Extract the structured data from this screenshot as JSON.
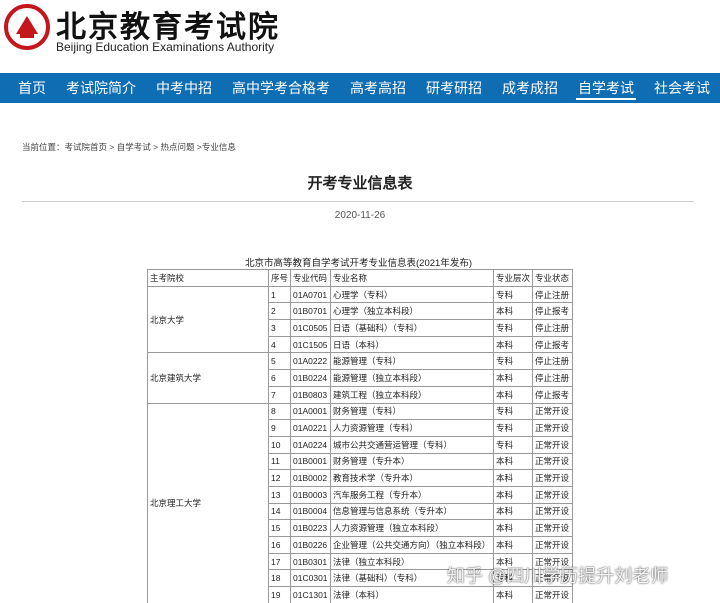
{
  "header": {
    "logo_cn": "北京教育考试院",
    "logo_en": "Beijing Education Examinations Authority",
    "brand_color": "#c4161c"
  },
  "nav": {
    "color": "#0e6db3",
    "items": [
      "首页",
      "考试院简介",
      "中考中招",
      "高中学考合格考",
      "高考高招",
      "研考研招",
      "成考成招",
      "自学考试",
      "社会考试"
    ],
    "active": "自学考试"
  },
  "breadcrumb": {
    "prefix": "当前位置：",
    "items": [
      "考试院首页",
      "自学考试",
      "热点问题",
      "专业信息"
    ],
    "separator": ">"
  },
  "article": {
    "title": "开考专业信息表",
    "date": "2020-11-26"
  },
  "table": {
    "caption": "北京市高等教育自学考试开考专业信息表(2021年发布)",
    "headers": [
      "主考院校",
      "序号",
      "专业代码",
      "专业名称",
      "专业层次",
      "专业状态"
    ],
    "groups": [
      {
        "school": "北京大学",
        "rows": [
          [
            "1",
            "01A0701",
            "心理学（专科）",
            "专科",
            "停止注册"
          ],
          [
            "2",
            "01B0701",
            "心理学（独立本科段）",
            "本科",
            "停止报考"
          ],
          [
            "3",
            "01C0505",
            "日语（基础科）（专科）",
            "专科",
            "停止注册"
          ],
          [
            "4",
            "01C1505",
            "日语（本科）",
            "本科",
            "停止报考"
          ]
        ]
      },
      {
        "school": "北京建筑大学",
        "rows": [
          [
            "5",
            "01A0222",
            "能源管理（专科）",
            "专科",
            "停止注册"
          ],
          [
            "6",
            "01B0224",
            "能源管理（独立本科段）",
            "本科",
            "停止注册"
          ],
          [
            "7",
            "01B0803",
            "建筑工程（独立本科段）",
            "本科",
            "停止报考"
          ]
        ]
      },
      {
        "school": "北京理工大学",
        "rows": [
          [
            "8",
            "01A0001",
            "财务管理（专科）",
            "专科",
            "正常开设"
          ],
          [
            "9",
            "01A0221",
            "人力资源管理（专科）",
            "专科",
            "正常开设"
          ],
          [
            "10",
            "01A0224",
            "城市公共交通营运管理（专科）",
            "专科",
            "正常开设"
          ],
          [
            "11",
            "01B0001",
            "财务管理（专升本）",
            "本科",
            "正常开设"
          ],
          [
            "12",
            "01B0002",
            "教育技术学（专升本）",
            "本科",
            "正常开设"
          ],
          [
            "13",
            "01B0003",
            "汽车服务工程（专升本）",
            "本科",
            "正常开设"
          ],
          [
            "14",
            "01B0004",
            "信息管理与信息系统（专升本）",
            "本科",
            "正常开设"
          ],
          [
            "15",
            "01B0223",
            "人力资源管理（独立本科段）",
            "本科",
            "正常开设"
          ],
          [
            "16",
            "01B0226",
            "企业管理（公共交通方向）（独立本科段）",
            "本科",
            "正常开设"
          ],
          [
            "17",
            "01B0301",
            "法律（独立本科段）",
            "本科",
            "正常开设"
          ],
          [
            "18",
            "01C0301",
            "法律（基础科）（专科）",
            "专科",
            "正常开设"
          ],
          [
            "19",
            "01C1301",
            "法律（本科）",
            "本科",
            "正常开设"
          ]
        ]
      }
    ]
  },
  "watermark": "知乎 @四川学历提升刘老师"
}
